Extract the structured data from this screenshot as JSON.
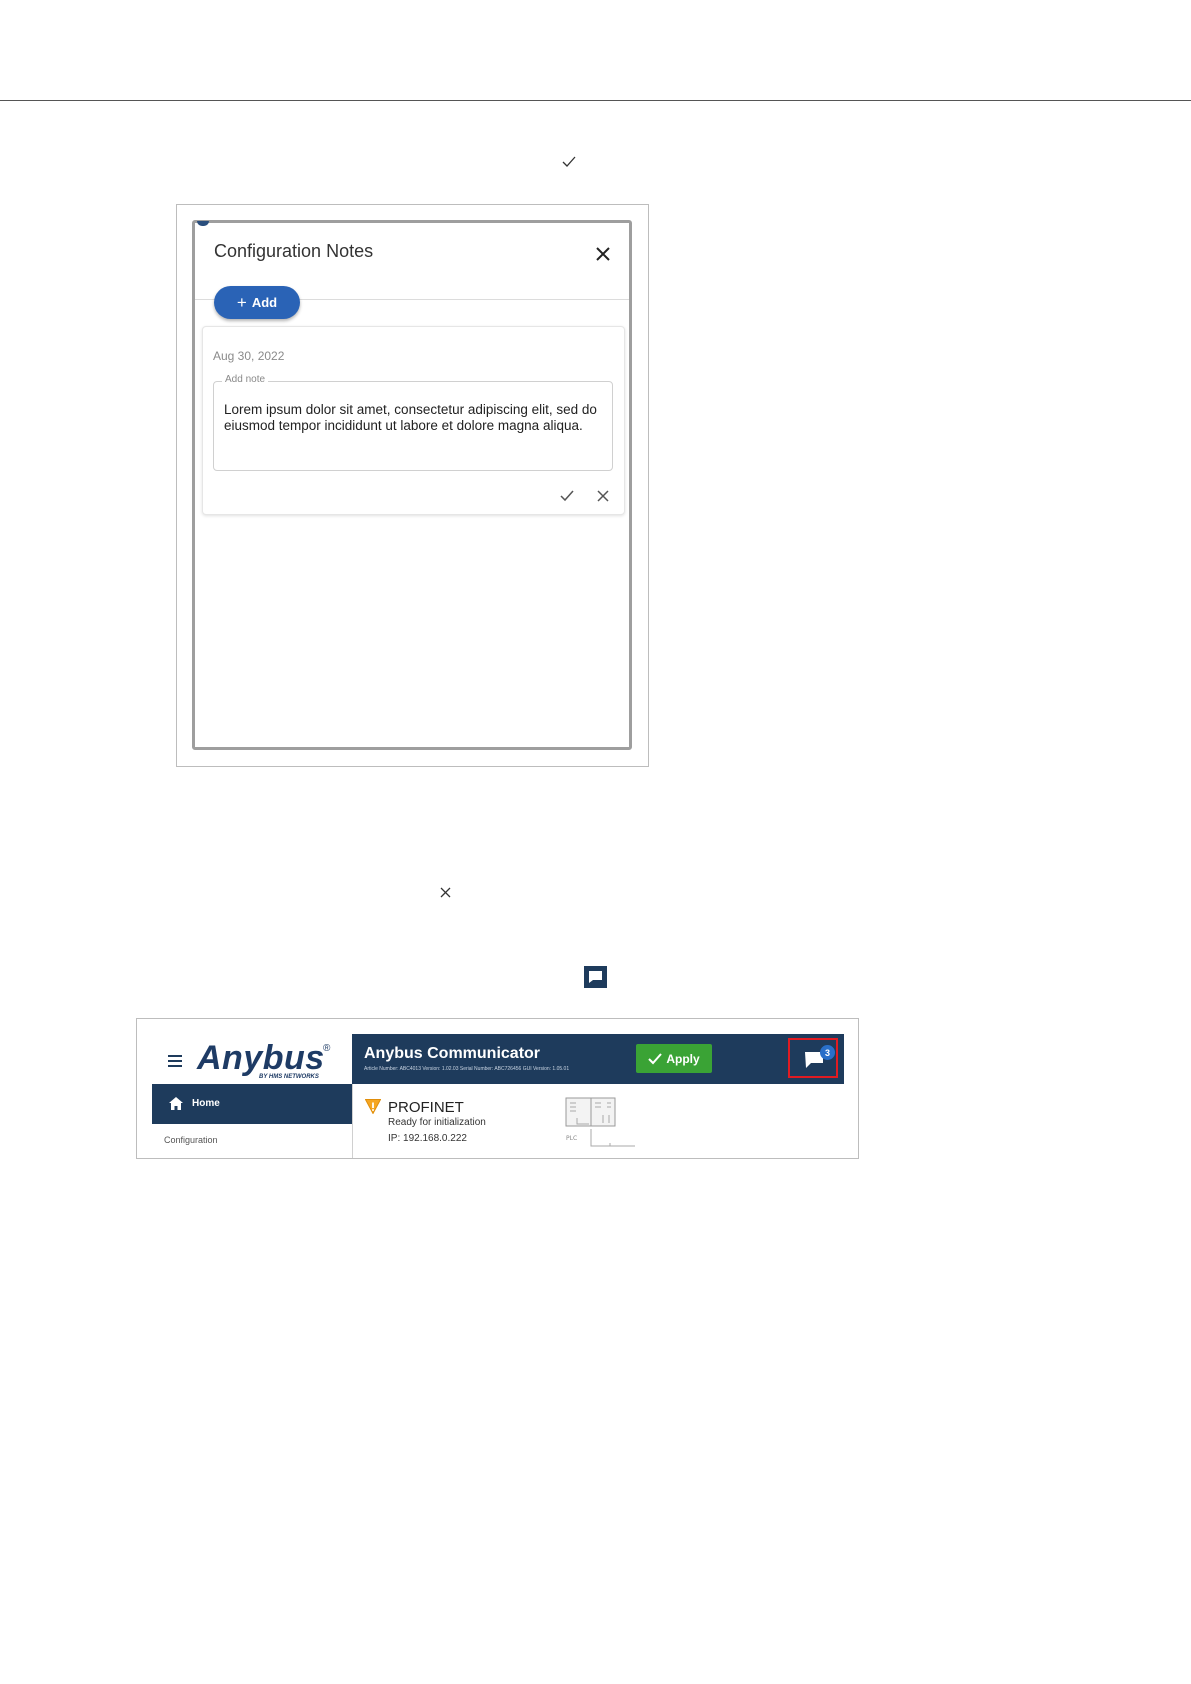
{
  "dialog": {
    "title": "Configuration Notes",
    "add_label": "Add",
    "note": {
      "date": "Aug 30, 2022",
      "field_label": "Add note",
      "text": "Lorem ipsum dolor sit amet, consectetur adipiscing elit, sed do eiusmod tempor incididunt ut labore et dolore magna aliqua."
    }
  },
  "anybus": {
    "logo": "Anybus",
    "logo_reg": "®",
    "logo_tagline": "BY HMS NETWORKS",
    "app_title": "Anybus Communicator",
    "app_meta": "Article Number: ABC4013 Version: 1.02.03 Serial Number: ABC726456 GUI Version: 1.05.01",
    "apply_label": "Apply",
    "notes_count": "3",
    "nav_home": "Home",
    "nav_configuration": "Configuration",
    "protocol_name": "PROFINET",
    "protocol_status": "Ready for initialization",
    "protocol_ip": "IP: 192.168.0.222",
    "diagram_label": "PLC"
  },
  "colors": {
    "navy": "#1e3b5c",
    "button_blue": "#2a63b6",
    "apply_green": "#3aa335",
    "highlight_red": "#e11b22",
    "warning_orange": "#f5a623"
  }
}
